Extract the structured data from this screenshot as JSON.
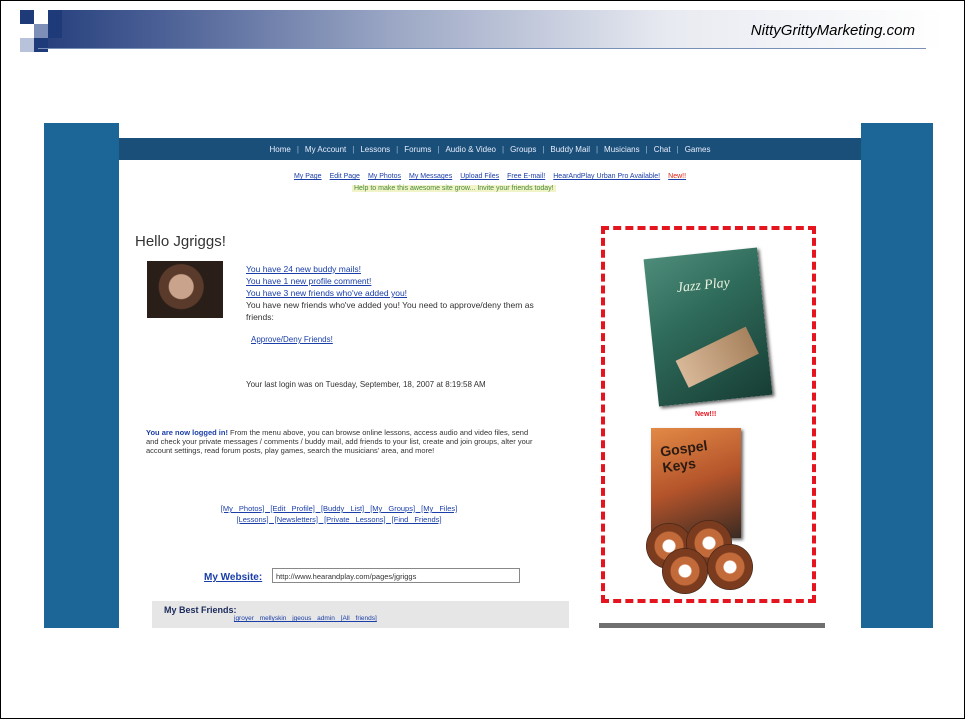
{
  "slide": {
    "site_name": "NittyGrittyMarketing.com"
  },
  "navbar": {
    "items": [
      "Home",
      "My Account",
      "Lessons",
      "Forums",
      "Audio & Video",
      "Groups",
      "Buddy Mail",
      "Musicians",
      "Chat",
      "Games"
    ]
  },
  "subnav": {
    "items": [
      "My Page",
      "Edit Page",
      "My Photos",
      "My Messages",
      "Upload Files",
      "Free E-mail!",
      "HearAndPlay Urban Pro Available!"
    ],
    "new_badge": "New!!",
    "notice": "Help to make this awesome site grow... Invite your friends today!"
  },
  "greeting": "Hello Jgriggs!",
  "messages": {
    "link1": "You have 24 new buddy mails!",
    "link2": "You have 1 new profile comment!",
    "link3": "You have 3 new friends who've added you!",
    "text": "You have new friends who've added you! You need to approve/deny them as friends:",
    "approve": "Approve/Deny Friends!"
  },
  "last_login": "Your last login was on Tuesday, September, 18, 2007 at 8:19:58 AM",
  "intro": {
    "bold": "You are now logged in!",
    "text": "From the menu above, you can browse online lessons, access audio and video files, send and check your private messages / comments / buddy mail, add friends to your list, create and join groups, alter your account settings, read forum posts, play games, search the musicians' area, and more!"
  },
  "quick_links": {
    "row1": "[My Photos]  [Edit Profile]  [Buddy List]  [My Groups]  [My Files]",
    "row2": "[Lessons]  [Newsletters]  [Private Lessons]  [Find Friends]"
  },
  "website": {
    "label": "My Website:",
    "value": "http://www.hearandplay.com/pages/jgriggs"
  },
  "friends": {
    "title": "My Best Friends:",
    "links": "jgroyer  mellyskin  jgeous  admin    [All friends]"
  },
  "ad": {
    "new_label": "New!!!",
    "book1_title": "Jazz Play",
    "book2_title": "Gospel Keys"
  },
  "colors": {
    "frame_blue": "#1b6696",
    "nav_blue": "#1a4f7a",
    "highlight_red": "#e5151f",
    "link_blue": "#1a3ea8"
  }
}
